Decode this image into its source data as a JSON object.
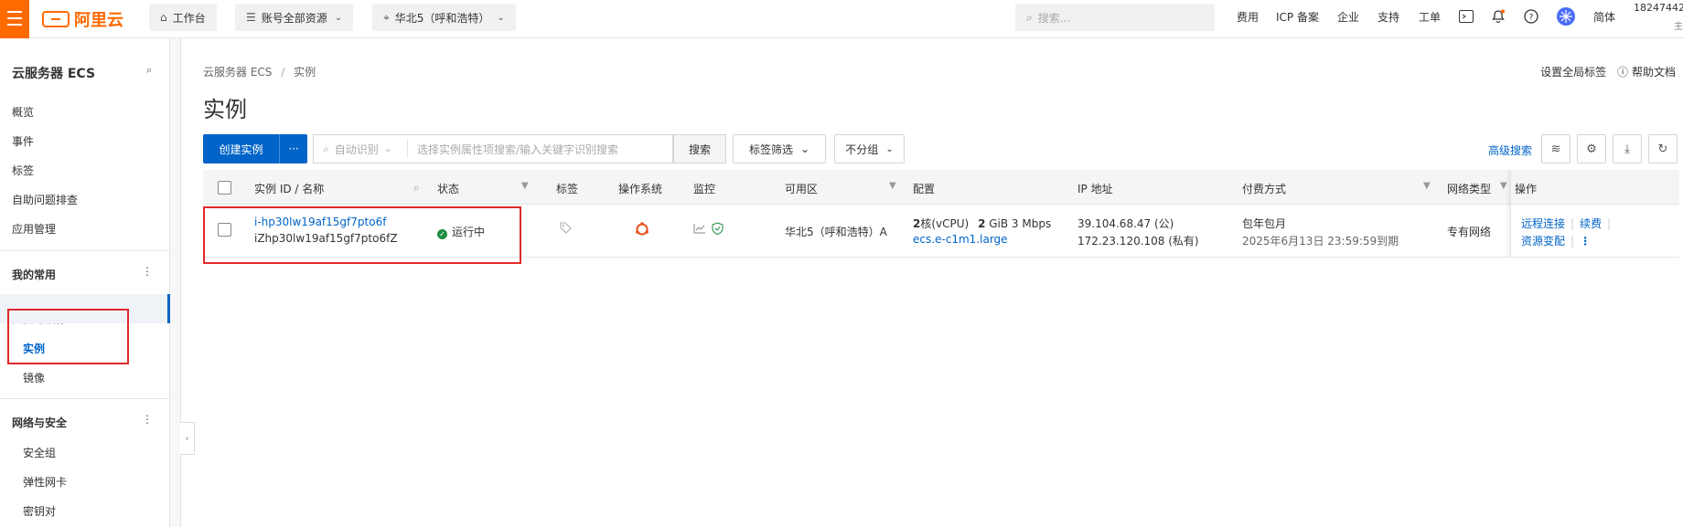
{
  "topbar": {
    "logo_text": "阿里云",
    "workbench": "工作台",
    "account_scope": "账号全部资源",
    "region": "华北5（呼和浩特）",
    "search_placeholder": "搜索...",
    "links": [
      "费用",
      "ICP 备案",
      "企业",
      "支持",
      "工单"
    ],
    "lang": "简体",
    "account_id": "18247442",
    "account_sub": "主"
  },
  "sidebar": {
    "title": "云服务器 ECS",
    "items": [
      "概览",
      "事件",
      "标签",
      "自助问题排查",
      "应用管理"
    ],
    "favorites": "我的常用",
    "group_instances": "实例与镜像",
    "sub_instances": [
      "实例",
      "镜像"
    ],
    "group_network": "网络与安全",
    "sub_network": [
      "安全组",
      "弹性网卡",
      "密钥对"
    ]
  },
  "main": {
    "breadcrumb_root": "云服务器 ECS",
    "breadcrumb_sep": "/",
    "breadcrumb_current": "实例",
    "global_tags": "设置全局标签",
    "help_docs": "帮助文档",
    "title": "实例",
    "create_btn": "创建实例",
    "more_btn": "···",
    "filter_select": "自动识别",
    "filter_placeholder": "选择实例属性项搜索/输入关键字识别搜索",
    "search_btn": "搜索",
    "tag_filter": "标签筛选",
    "group_select": "不分组",
    "advanced_search": "高级搜索"
  },
  "table": {
    "headers": [
      "实例 ID / 名称",
      "状态",
      "标签",
      "操作系统",
      "监控",
      "可用区",
      "配置",
      "IP 地址",
      "付费方式",
      "网络类型",
      "操作"
    ],
    "row": {
      "instance_id": "i-hp30lw19af15gf7pto6f",
      "instance_name": "iZhp30lw19af15gf7pto6fZ",
      "status": "运行中",
      "zone": "华北5（呼和浩特）A",
      "cpu_count": "2",
      "cpu_unit": "核(vCPU)",
      "mem": "2",
      "mem_unit": "GiB 3 Mbps",
      "instance_type": "ecs.e-c1m1.large",
      "public_ip": "39.104.68.47 (公)",
      "private_ip": "172.23.120.108 (私有)",
      "pay_type": "包年包月",
      "expire": "2025年6月13日 23:59:59到期",
      "network": "专有网络",
      "op_remote": "远程连接",
      "op_renew": "续费",
      "op_resize": "资源变配"
    }
  },
  "colors": {
    "brand": "#ff6a00",
    "primary": "#0064c8",
    "running": "#1e8e3e",
    "highlight": "#e0292c"
  }
}
